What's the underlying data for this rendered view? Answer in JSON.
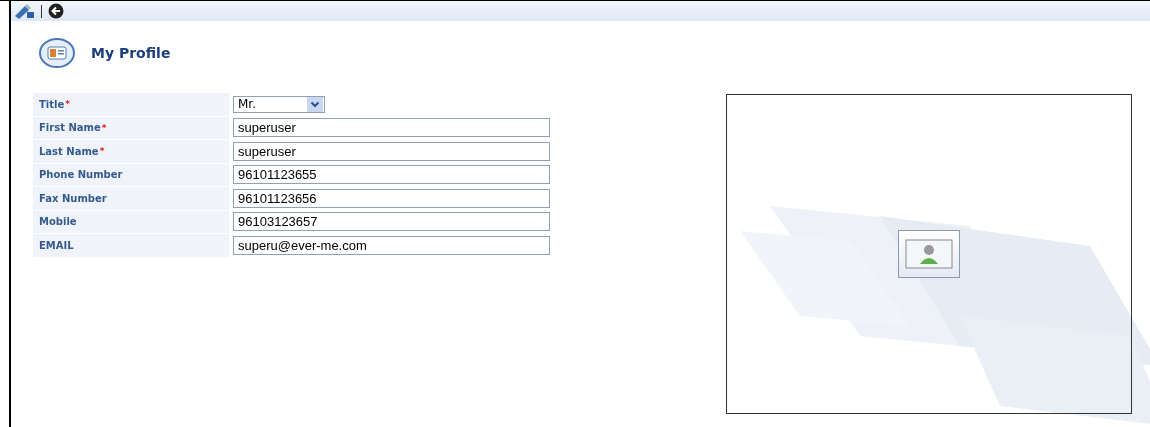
{
  "header": {
    "title": "My Profile"
  },
  "fields": [
    {
      "label": "Title",
      "marker": "*",
      "kind": "select",
      "value": "Mr."
    },
    {
      "label": "First Name",
      "marker": "*",
      "kind": "text",
      "value": "superuser"
    },
    {
      "label": "Last Name",
      "marker": "*",
      "kind": "text",
      "value": "superuser"
    },
    {
      "label": "Phone Number",
      "kind": "text",
      "value": "96101123655"
    },
    {
      "label": "Fax Number",
      "kind": "text",
      "value": "96101123656"
    },
    {
      "label": "Mobile",
      "kind": "text",
      "value": "96103123657"
    },
    {
      "label": "EMAIL",
      "kind": "text",
      "value": "superu@ever-me.com"
    }
  ]
}
